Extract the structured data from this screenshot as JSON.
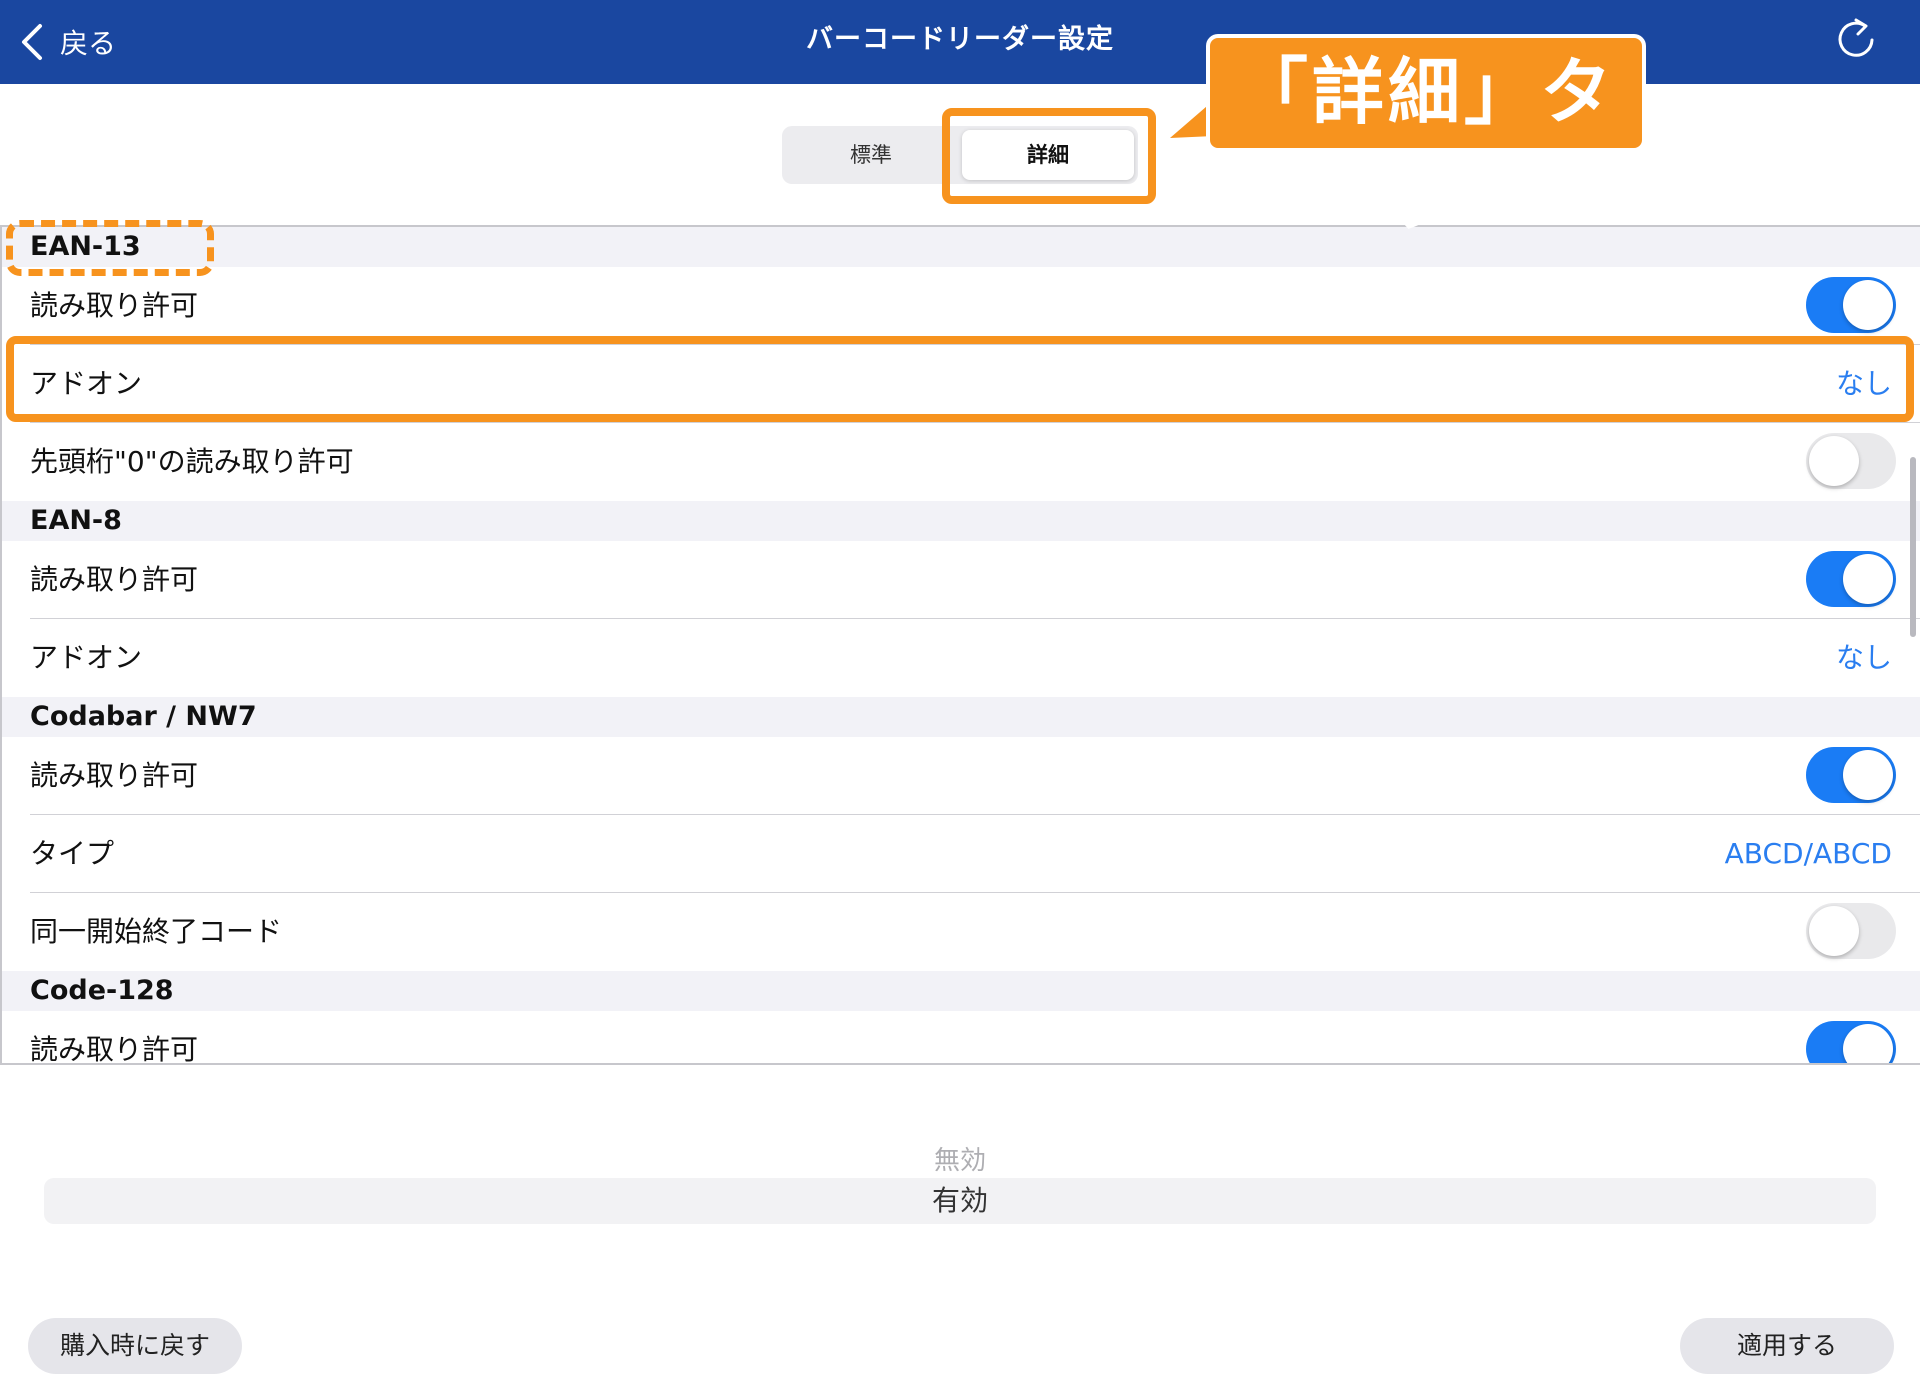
{
  "navbar": {
    "back_label": "戻る",
    "title": "バーコードリーダー設定",
    "refresh_icon": "refresh-icon"
  },
  "segment": {
    "standard_label": "標準",
    "advanced_label": "詳細",
    "selected": "詳細"
  },
  "annotation": {
    "callout_label": "「詳細」タブ",
    "color": "#f7931e"
  },
  "sections": [
    {
      "header": "EAN-13",
      "rows": [
        {
          "label": "読み取り許可",
          "kind": "toggle",
          "on": true
        },
        {
          "label": "アドオン",
          "kind": "value",
          "value": "なし"
        },
        {
          "label": "先頭桁\"0\"の読み取り許可",
          "kind": "toggle",
          "on": false
        }
      ]
    },
    {
      "header": "EAN-8",
      "rows": [
        {
          "label": "読み取り許可",
          "kind": "toggle",
          "on": true
        },
        {
          "label": "アドオン",
          "kind": "value",
          "value": "なし"
        }
      ]
    },
    {
      "header": "Codabar / NW7",
      "rows": [
        {
          "label": "読み取り許可",
          "kind": "toggle",
          "on": true
        },
        {
          "label": "タイプ",
          "kind": "value",
          "value": "ABCD/ABCD"
        },
        {
          "label": "同一開始終了コード",
          "kind": "toggle",
          "on": false
        }
      ]
    },
    {
      "header": "Code-128",
      "rows": [
        {
          "label": "読み取り許可",
          "kind": "toggle",
          "on": true
        }
      ]
    }
  ],
  "picker": {
    "faded_option": "無効",
    "selected_option": "有効"
  },
  "buttons": {
    "reset_label": "購入時に戻す",
    "apply_label": "適用する"
  },
  "colors": {
    "navbar": "#1a47a0",
    "accent": "#1a7cf5",
    "link": "#2a7ef0",
    "annotation": "#f7931e"
  }
}
